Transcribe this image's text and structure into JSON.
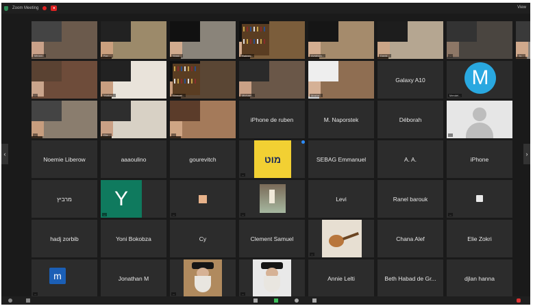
{
  "meeting": {
    "title": "Zoom Meeting",
    "view_label": "View",
    "controls": [
      "mute",
      "video",
      "participants",
      "share",
      "record",
      "reactions",
      "end"
    ]
  },
  "grid": {
    "rows": [
      [
        {
          "type": "video",
          "label": "Miriam...",
          "scene": "room"
        },
        {
          "type": "video",
          "label": "Rav ...",
          "scene": "speaker"
        },
        {
          "type": "video",
          "label": "Yossi...",
          "scene": "hat"
        },
        {
          "type": "video",
          "label": "Rabbin...",
          "scene": "books"
        },
        {
          "type": "video",
          "label": "Avraham...",
          "scene": "hat2"
        },
        {
          "type": "video",
          "label": "David...",
          "scene": "wall"
        },
        {
          "type": "video",
          "label": "...",
          "scene": "dim"
        },
        {
          "type": "video",
          "label": "Jo...",
          "scene": "close"
        }
      ],
      [
        {
          "type": "video",
          "label": "...",
          "scene": "window"
        },
        {
          "type": "video",
          "label": "Yaakov...",
          "scene": "kippah"
        },
        {
          "type": "video",
          "label": "Shmuel...",
          "scene": "shelf"
        },
        {
          "type": "video",
          "label": "Michael...",
          "scene": "closeup"
        },
        {
          "type": "video",
          "label": "Moshe...",
          "scene": "elder"
        },
        {
          "type": "name",
          "name": "Galaxy A10"
        },
        {
          "type": "avatar",
          "letter": "M",
          "color": "#29a8e0",
          "label": "Mendel..."
        },
        {
          "type": "empty"
        }
      ],
      [
        {
          "type": "video",
          "label": "...",
          "scene": "kitchen"
        },
        {
          "type": "video",
          "label": "Elie...",
          "scene": "closeup2"
        },
        {
          "type": "video",
          "label": "...",
          "scene": "face"
        },
        {
          "type": "name",
          "name": "iPhone de ruben"
        },
        {
          "type": "name",
          "name": "M. Naporstek"
        },
        {
          "type": "name",
          "name": "Déborah"
        },
        {
          "type": "silhouette",
          "label": "..."
        },
        {
          "type": "empty"
        }
      ],
      [
        {
          "type": "name",
          "name": "Noemie Liberow"
        },
        {
          "type": "name",
          "name": "aaaoulino"
        },
        {
          "type": "name",
          "name": "gourevitch"
        },
        {
          "type": "logo",
          "text": "מוט",
          "label": "..."
        },
        {
          "type": "name",
          "name": "SEBAG Emmanuel"
        },
        {
          "type": "name",
          "name": "A. A."
        },
        {
          "type": "name",
          "name": "iPhone"
        },
        {
          "type": "empty"
        }
      ],
      [
        {
          "type": "name",
          "name": "מרביץ"
        },
        {
          "type": "avatar",
          "letter": "Y",
          "color": "#0f7a5e",
          "label": "..."
        },
        {
          "type": "square",
          "color": "#e7b28a",
          "label": "..."
        },
        {
          "type": "picture",
          "label": "..."
        },
        {
          "type": "name",
          "name": "Levi"
        },
        {
          "type": "name",
          "name": "Ranel barouk"
        },
        {
          "type": "appicon",
          "label": "..."
        },
        {
          "type": "empty"
        }
      ],
      [
        {
          "type": "name",
          "name": "hadj zorbib"
        },
        {
          "type": "name",
          "name": "Yoni Bokobza"
        },
        {
          "type": "name",
          "name": "Cy"
        },
        {
          "type": "name",
          "name": "Clement Samuel"
        },
        {
          "type": "guitar",
          "label": "..."
        },
        {
          "type": "name",
          "name": "Chana Alef"
        },
        {
          "type": "name",
          "name": "Elie Zokri"
        },
        {
          "type": "empty"
        }
      ],
      [
        {
          "type": "avatar",
          "letter": "m",
          "color": "#1b5fb6",
          "label": "..."
        },
        {
          "type": "name",
          "name": "Jonathan M"
        },
        {
          "type": "rebbe",
          "label": "..."
        },
        {
          "type": "rebbe2",
          "label": "..."
        },
        {
          "type": "name",
          "name": "Annie Lelti"
        },
        {
          "type": "name",
          "name": "Beth Habad de Gr..."
        },
        {
          "type": "name",
          "name": "djlan hanna"
        },
        {
          "type": "empty"
        }
      ]
    ]
  }
}
